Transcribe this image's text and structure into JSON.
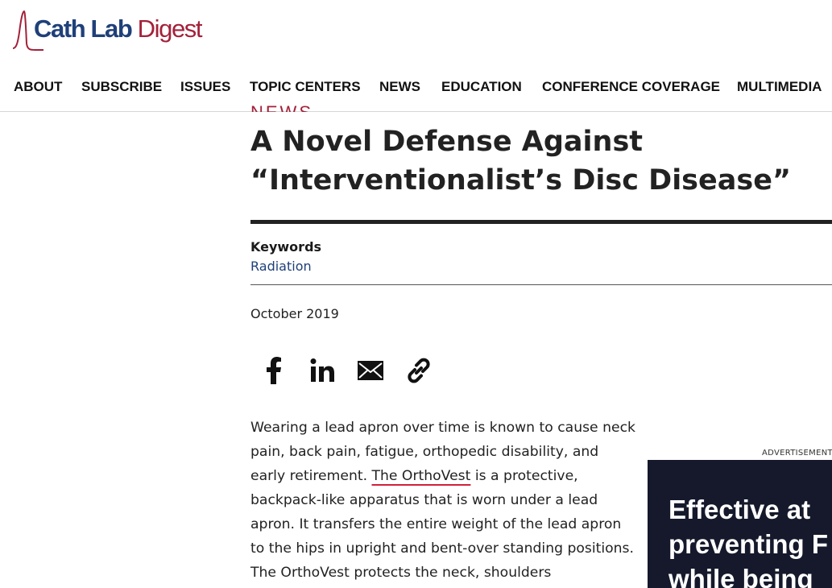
{
  "brand": {
    "name_part1": "Cath Lab",
    "name_part2": "Digest",
    "colors": {
      "blue": "#1f4079",
      "red": "#a3213a"
    }
  },
  "nav": {
    "items": [
      {
        "label": "ABOUT"
      },
      {
        "label": "SUBSCRIBE"
      },
      {
        "label": "ISSUES"
      },
      {
        "label": "TOPIC CENTERS"
      },
      {
        "label": "NEWS"
      },
      {
        "label": "EDUCATION"
      },
      {
        "label": "CONFERENCE COVERAGE"
      },
      {
        "label": "MULTIMEDIA"
      }
    ]
  },
  "article": {
    "section": "NEWS",
    "title": "A Novel Defense Against “Interventionalist’s Disc Disease”",
    "keywords_label": "Keywords",
    "keyword": "Radiation",
    "date": "October 2019",
    "share_icons": [
      "facebook-icon",
      "linkedin-icon",
      "email-icon",
      "link-icon"
    ],
    "body_before_link": "Wearing a lead apron over time is known to cause neck pain, back pain, fatigue, orthopedic disability, and early retirement. ",
    "body_link": "The OrthoVest",
    "body_after_link": " is a protective, backpack-like apparatus that is worn under a lead apron. It transfers the entire weight of the lead apron to the hips in upright and bent-over standing positions. The OrthoVest protects the neck, shoulders"
  },
  "ad": {
    "label": "ADVERTISEMENT",
    "lines": [
      "Effective at",
      "preventing F",
      "while being"
    ],
    "background": "#15192b"
  }
}
